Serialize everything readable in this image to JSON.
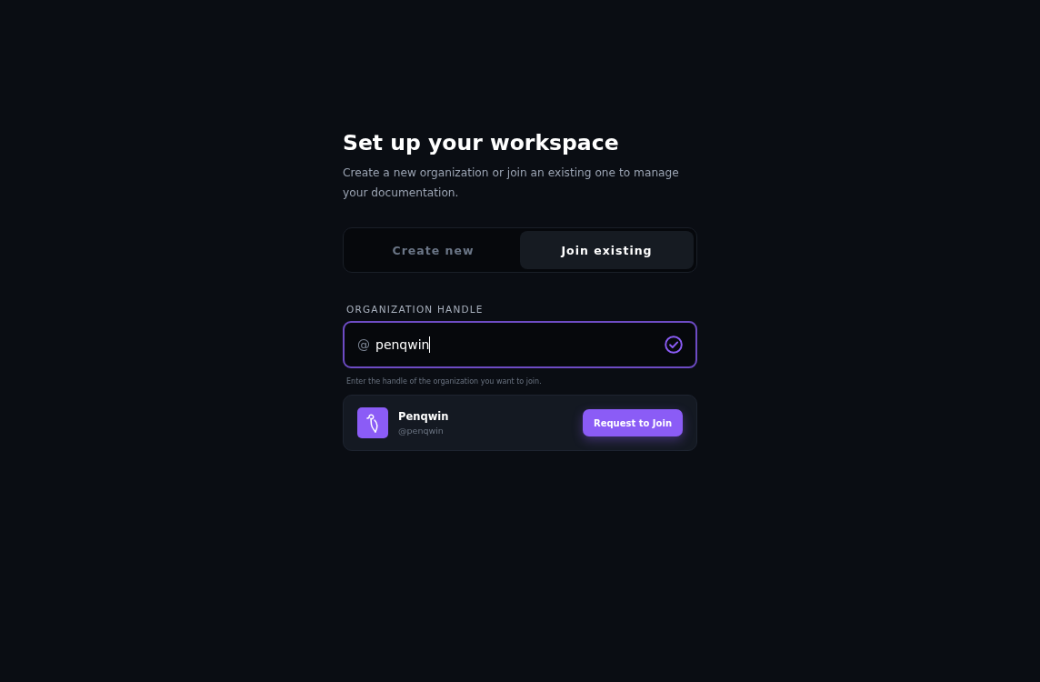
{
  "heading": {
    "title": "Set up your workspace",
    "subtitle": "Create a new organization or join an existing one to manage your documentation."
  },
  "tabs": [
    {
      "label": "Create new",
      "selected": false
    },
    {
      "label": "Join existing",
      "selected": true
    }
  ],
  "handle_field": {
    "label": "ORGANIZATION HANDLE",
    "prefix": "@",
    "value": "penqwin",
    "focused": true,
    "valid": true,
    "hint": "Enter the handle of the organization you want to join."
  },
  "result": {
    "name": "Penqwin",
    "handle": "@penqwin",
    "button": "Request to Join"
  }
}
